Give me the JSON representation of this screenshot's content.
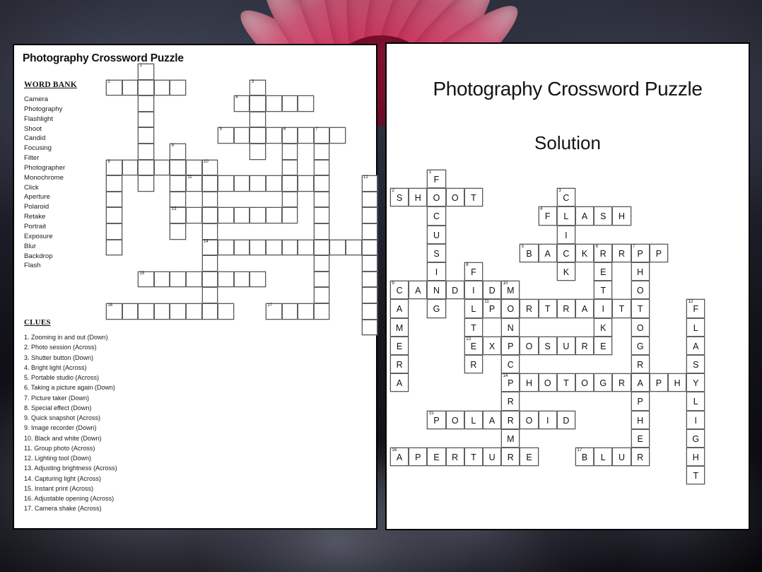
{
  "background": {
    "description": "pink-flower-on-dark-rock-photo",
    "accent_color": "#e3325f",
    "dark_color": "#15161f"
  },
  "puzzle_sheet": {
    "title": "Photography Crossword Puzzle",
    "word_bank_heading": "WORD BANK",
    "word_bank": [
      "Camera",
      "Photography",
      "Flashlight",
      "Shoot",
      "Candid",
      "Focusing",
      "Filter",
      "Photographer",
      "Monochrome",
      "Click",
      "Aperture",
      "Polaroid",
      "Retake",
      "Portrait",
      "Exposure",
      "Blur",
      "Backdrop",
      "Flash"
    ],
    "clues_heading": "CLUES",
    "clues": [
      "1. Zooming in and out (Down)",
      "2. Photo session (Across)",
      "3. Shutter button (Down)",
      "4. Bright light (Across)",
      "5. Portable studio (Across)",
      "6. Taking a picture again (Down)",
      "7. Picture taker (Down)",
      "8. Special effect (Down)",
      "9. Quick snapshot (Across)",
      "9. Image recorder (Down)",
      "10. Black and white (Down)",
      "11. Group photo (Across)",
      "12. Lighting tool (Down)",
      "13. Adjusting brightness (Across)",
      "14. Capturing light (Across)",
      "15. Instant print (Across)",
      "16. Adjustable opening (Across)",
      "17. Camera shake (Across)"
    ]
  },
  "solution_sheet": {
    "title": "Photography Crossword Puzzle",
    "subtitle": "Solution"
  },
  "crossword": {
    "cell_size_puzzle": 22.6,
    "cell_size_solution": 26.2,
    "entries": [
      {
        "number": 1,
        "answer": "FOCUSING",
        "direction": "down",
        "clue": "Zooming in and out",
        "col": 2,
        "row": 0
      },
      {
        "number": 2,
        "answer": "SHOOT",
        "direction": "across",
        "clue": "Photo session",
        "col": 0,
        "row": 1
      },
      {
        "number": 3,
        "answer": "CLICK",
        "direction": "down",
        "clue": "Shutter button",
        "col": 9,
        "row": 1
      },
      {
        "number": 4,
        "answer": "FLASH",
        "direction": "across",
        "clue": "Bright light",
        "col": 8,
        "row": 2
      },
      {
        "number": 5,
        "answer": "BACKDROP",
        "direction": "across",
        "clue": "Portable studio",
        "col": 7,
        "row": 4
      },
      {
        "number": 6,
        "answer": "RETAKE",
        "direction": "down",
        "clue": "Taking a picture again",
        "col": 11,
        "row": 4
      },
      {
        "number": 7,
        "answer": "PHOTOGRAPHER",
        "direction": "down",
        "clue": "Picture taker",
        "col": 13,
        "row": 4
      },
      {
        "number": 8,
        "answer": "FILTER",
        "direction": "down",
        "clue": "Special effect",
        "col": 4,
        "row": 5
      },
      {
        "number": 9,
        "answer": "CANDID",
        "direction": "across",
        "clue": "Quick snapshot",
        "col": 0,
        "row": 6
      },
      {
        "number": 9,
        "answer": "CAMERA",
        "direction": "down",
        "clue": "Image recorder",
        "col": 0,
        "row": 6
      },
      {
        "number": 10,
        "answer": "MONOCHROME",
        "direction": "down",
        "clue": "Black and white",
        "col": 6,
        "row": 6
      },
      {
        "number": 11,
        "answer": "PORTRAIT",
        "direction": "across",
        "clue": "Group photo",
        "col": 5,
        "row": 7
      },
      {
        "number": 12,
        "answer": "FLASHLIGHT",
        "direction": "down",
        "clue": "Lighting tool",
        "col": 16,
        "row": 7
      },
      {
        "number": 13,
        "answer": "EXPOSURE",
        "direction": "across",
        "clue": "Adjusting brightness",
        "col": 4,
        "row": 9
      },
      {
        "number": 14,
        "answer": "PHOTOGRAPHY",
        "direction": "across",
        "clue": "Capturing light",
        "col": 6,
        "row": 11
      },
      {
        "number": 15,
        "answer": "POLAROID",
        "direction": "across",
        "clue": "Instant print",
        "col": 2,
        "row": 13
      },
      {
        "number": 16,
        "answer": "APERTURE",
        "direction": "across",
        "clue": "Adjustable opening",
        "col": 0,
        "row": 15
      },
      {
        "number": 17,
        "answer": "BLUR",
        "direction": "across",
        "clue": "Camera shake",
        "col": 10,
        "row": 15
      }
    ]
  }
}
